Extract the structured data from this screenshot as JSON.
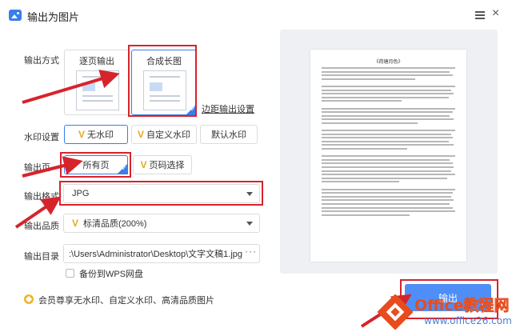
{
  "window": {
    "title": "输出为图片"
  },
  "labels": {
    "mode": "输出方式",
    "watermark": "水印设置",
    "range": "输出页",
    "format": "输出格式",
    "quality": "输出品质",
    "directory": "输出目录"
  },
  "mode": {
    "options": [
      "逐页输出",
      "合成长图"
    ],
    "selected": "合成长图",
    "margin_link": "边距输出设置"
  },
  "watermark": {
    "options": [
      "无水印",
      "自定义水印",
      "默认水印"
    ],
    "selected": "无水印"
  },
  "range": {
    "options": [
      "所有页",
      "页码选择"
    ],
    "selected": "所有页"
  },
  "format": {
    "value": "JPG"
  },
  "quality": {
    "value": "标清品质(200%)"
  },
  "directory": {
    "value": ":\\Users\\Administrator\\Desktop\\文字文稿1.jpg",
    "more": "···"
  },
  "backup": {
    "label": "备份到WPS网盘",
    "checked": false
  },
  "footer": {
    "text": "会员尊享无水印、自定义水印、高清品质图片"
  },
  "preview": {
    "doc_title": "《荷塘月色》"
  },
  "export_button": "输出",
  "overlay_watermark": {
    "title_part1": "Office",
    "title_part2": "教程网",
    "url": "www.office26.com"
  },
  "colors": {
    "accent": "#3b7de9",
    "export_button": "#4f8ef7",
    "annotation_red": "#d6242c",
    "vip_gold": "#e8a61c"
  }
}
